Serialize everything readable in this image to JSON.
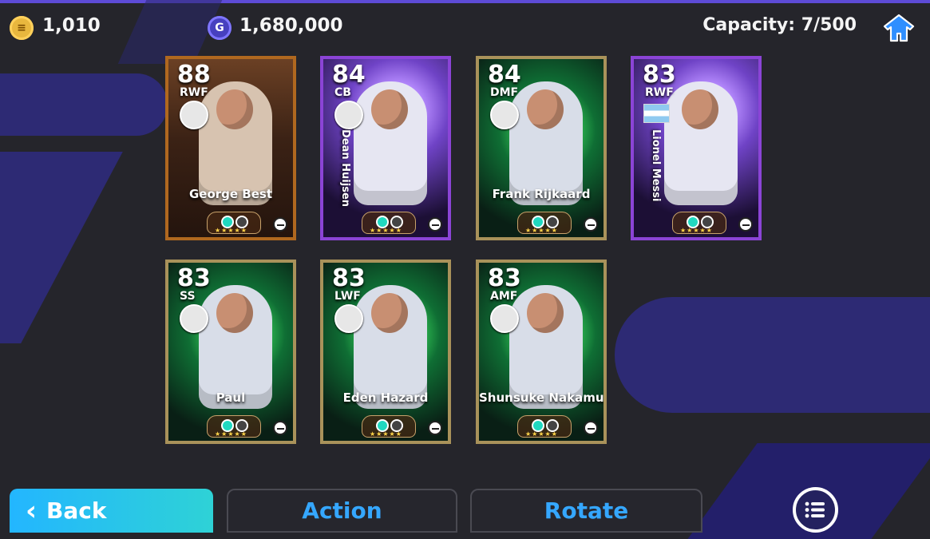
{
  "header": {
    "gp_value": "1,010",
    "gcoin_value": "1,680,000",
    "capacity": "Capacity: 7/500"
  },
  "cards": [
    {
      "rating": "88",
      "position": "RWF",
      "name": "George Best",
      "name_orientation": "horizontal",
      "style": "legend",
      "stars": 5,
      "icon": "club-crest-icon"
    },
    {
      "rating": "84",
      "position": "CB",
      "name": "Dean Huijsen",
      "name_orientation": "vertical",
      "style": "purple",
      "stars": 5,
      "icon": "club-crest-icon"
    },
    {
      "rating": "84",
      "position": "DMF",
      "name": "Frank Rijkaard",
      "name_orientation": "horizontal",
      "style": "green",
      "stars": 5,
      "icon": "club-crest-icon"
    },
    {
      "rating": "83",
      "position": "RWF",
      "name": "Lionel Messi",
      "name_orientation": "vertical",
      "style": "purple",
      "stars": 5,
      "icon": "argentina-flag-icon"
    },
    {
      "rating": "83",
      "position": "SS",
      "name": "Paul",
      "name_orientation": "horizontal",
      "style": "green",
      "stars": 5,
      "icon": "club-crest-icon"
    },
    {
      "rating": "83",
      "position": "LWF",
      "name": "Eden Hazard",
      "name_orientation": "horizontal",
      "style": "green",
      "stars": 5,
      "icon": "club-crest-icon"
    },
    {
      "rating": "83",
      "position": "AMF",
      "name": "Shunsuke Nakamura",
      "name_orientation": "horizontal",
      "style": "green",
      "stars": 5,
      "icon": "club-crest-icon"
    }
  ],
  "footer": {
    "back_label": "Back",
    "action_label": "Action",
    "rotate_label": "Rotate"
  },
  "colors": {
    "accent_blue": "#35a7ff",
    "back_start": "#23b6ff",
    "back_end": "#2ed2d6",
    "bg_dark": "#25252b"
  }
}
